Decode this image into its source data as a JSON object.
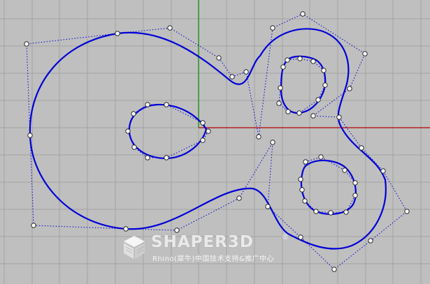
{
  "scene": {
    "background": "#bfbfbf",
    "grid_color": "#a3a3a3",
    "axis_x_color": "#b80000",
    "axis_y_color": "#008800",
    "curve_color": "#0000d8",
    "control_polygon_color": "#0000d8",
    "control_point_fill": "#ffffff"
  },
  "watermark": {
    "logo": "shaper3d-cube-icon",
    "brand": "SHAPER3D",
    "registered_mark": "®",
    "subtitle": "Rhino(犀牛)中国技术支持&推广中心"
  }
}
